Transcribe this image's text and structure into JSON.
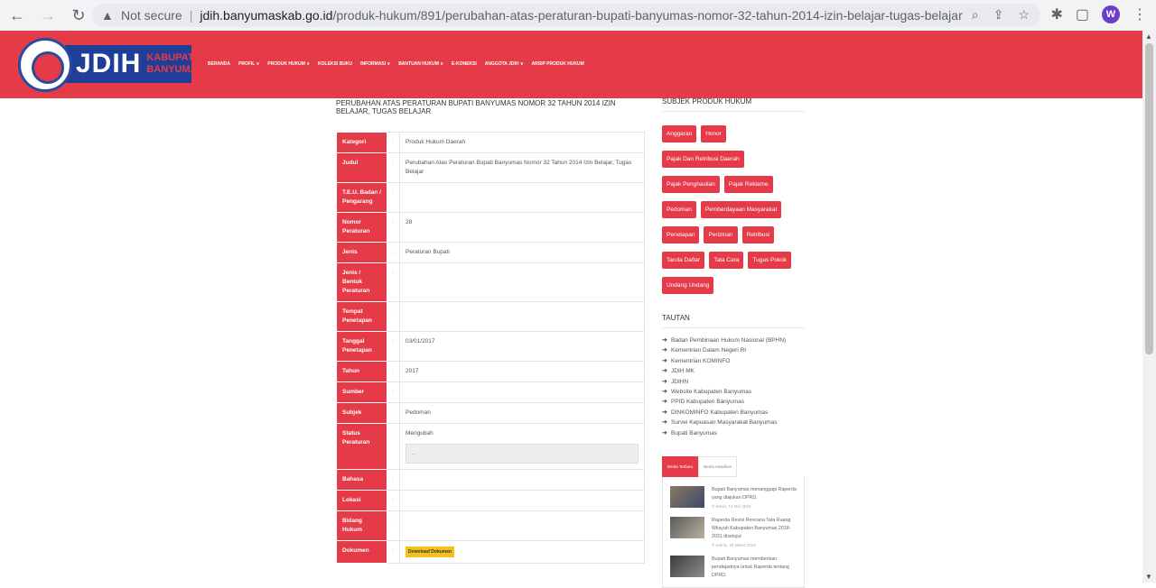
{
  "browser": {
    "not_secure": "Not secure",
    "host": "jdih.banyumaskab.go.id",
    "path": "/produk-hukum/891/perubahan-atas-peraturan-bupati-banyumas-nomor-32-tahun-2014-izin-belajar-tugas-belajar",
    "profile_initial": "W"
  },
  "site": {
    "logo_main": "JDIH",
    "logo_line1": "KABUPATEN",
    "logo_line2": "BANYUMAS",
    "menu": [
      "BERANDA",
      "PROFIL ∨",
      "PRODUK HUKUM ∨",
      "KOLEKSI BUKU",
      "INFORMASI ∨",
      "BANTUAN HUKUM ∨",
      "E-KONEKSI",
      "ANGGOTA JDIH ∨",
      "ARSIP PRODUK HUKUM"
    ]
  },
  "page_title": "PERUBAHAN ATAS PERATURAN BUPATI BANYUMAS NOMOR 32 TAHUN 2014 IZIN BELAJAR, TUGAS BELAJAR",
  "detail": [
    {
      "k": "Kategori",
      "v": "Produk Hukum Daerah"
    },
    {
      "k": "Judul",
      "v": "Perubahan Atas Peraturan Bupati Banyumas Nomor 32 Tahun 2014 Izin Belajar, Tugas Belajar"
    },
    {
      "k": "T.E.U. Badan / Pengarang",
      "v": ""
    },
    {
      "k": "Nomor Peraturan",
      "v": "28"
    },
    {
      "k": "Jenis",
      "v": "Peraturan Bupati"
    },
    {
      "k": "Jenis / Bentuk Peraturan",
      "v": ""
    },
    {
      "k": "Tempat Penetapan",
      "v": ""
    },
    {
      "k": "Tanggal Penetapan",
      "v": "03/01/2017"
    },
    {
      "k": "Tahun",
      "v": "2017"
    },
    {
      "k": "Sumber",
      "v": ""
    },
    {
      "k": "Subjek",
      "v": "Pedoman"
    },
    {
      "k": "Status Peraturan",
      "v": "Mengubah",
      "box": "--"
    },
    {
      "k": "Bahasa",
      "v": ""
    },
    {
      "k": "Lokasi",
      "v": ""
    },
    {
      "k": "Bidang Hukum",
      "v": ""
    },
    {
      "k": "Dokumen",
      "v": "",
      "download": "Download Dokumen"
    }
  ],
  "sidebar": {
    "subjek_title": "SUBJEK PRODUK HUKUM",
    "tags": [
      "Anggaran",
      "Honor",
      "Pajak Dan Retribusi Daerah",
      "Pajak Penghasilan",
      "Pajak Reklame",
      "Pedoman",
      "Pemberdayaan Masyarakat",
      "Penetapan",
      "Perizinan",
      "Retribusi",
      "Tanda Daftar",
      "Tata Cara",
      "Tugas Pokok",
      "Undang Undang"
    ],
    "tautan_title": "TAUTAN",
    "links": [
      "Badan Pembinaan Hukum Nasional (BPHN)",
      "Kementrian Dalam Negeri RI",
      "Kementrian KOMINFO",
      "JDIH MK",
      "JDIHN",
      "Website Kabupaten Banyumas",
      "PPID Kabupaten Banyumas",
      "DINKOMINFO Kabupaten Banyumas",
      "Survei Kepuasan Masyarakat Banyumas",
      "Bupati Banyumas"
    ],
    "tab_active": "Berita Terbaru",
    "tab_other": "Berita Headline",
    "news": [
      {
        "title": "Bupati Banyumas menanggapi Raperda yang diajukan DPRD.",
        "date": "Senin, 13 Mei 2019"
      },
      {
        "title": "Raperda Revisi Rencana Tata Ruang Wilayah Kabupaten Banyumas 2018-2031 disetujui",
        "date": "Kamis, 28 Maret 2019"
      },
      {
        "title": "Bupati Banyumas memberikan pendapatnya untuk Raperda tentang DPRD.",
        "date": ""
      }
    ]
  }
}
